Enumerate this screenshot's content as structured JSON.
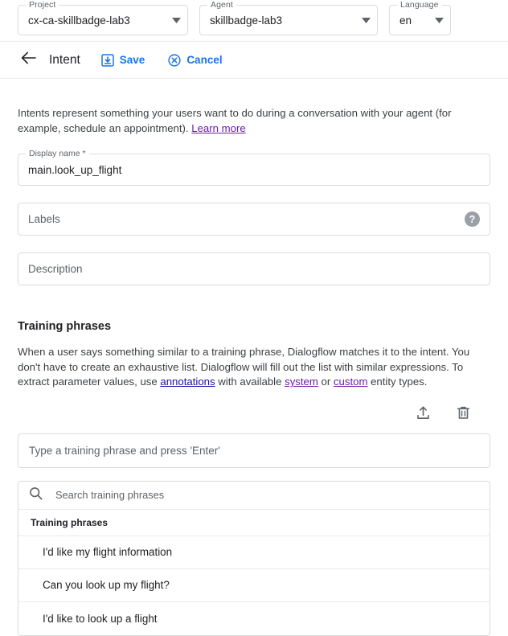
{
  "selectors": [
    {
      "legend": "Project",
      "value": "cx-ca-skillbadge-lab3",
      "icon": "chevron-down-icon"
    },
    {
      "legend": "Agent",
      "value": "skillbadge-lab3",
      "icon": "chevron-down-icon"
    },
    {
      "legend": "Language",
      "value": "en",
      "icon": "chevron-down-icon"
    }
  ],
  "header": {
    "back_icon": "arrow-back-icon",
    "title": "Intent",
    "save_label": "Save",
    "save_icon": "save-icon",
    "cancel_label": "Cancel",
    "cancel_icon": "cancel-circle-icon"
  },
  "intro": {
    "text_before": "Intents represent something your users want to do during a conversation with your agent (for example, schedule an appointment). ",
    "link_label": "Learn more"
  },
  "fields": {
    "display_name": {
      "legend": "Display name *",
      "value": "main.look_up_flight"
    },
    "labels": {
      "placeholder": "Labels",
      "help_icon": "help-circle-icon"
    },
    "description": {
      "placeholder": "Description"
    }
  },
  "training": {
    "section_title": "Training phrases",
    "desc_part1": "When a user says something similar to a training phrase, Dialogflow matches it to the intent. You don't have to create an exhaustive list. Dialogflow will fill out the list with similar expressions. To extract parameter values, use ",
    "link_annotations": "annotations",
    "desc_part2": " with available ",
    "link_system": "system",
    "desc_part3": " or ",
    "link_custom": "custom",
    "desc_part4": " entity types.",
    "upload_icon": "upload-icon",
    "delete_icon": "delete-trash-icon",
    "phrase_placeholder": "Type a training phrase and press 'Enter'",
    "search_icon": "search-icon",
    "search_placeholder": "Search training phrases",
    "column_header": "Training phrases",
    "rows": [
      "I'd like my flight information",
      "Can you look up my flight?",
      "I'd like to look up a flight"
    ]
  },
  "colors": {
    "accent_blue": "#1a73e8",
    "link_visited": "#681da8",
    "link_blue": "#1a0dab",
    "border": "#dadce0",
    "text_primary": "#202124",
    "text_secondary": "#5f6368"
  }
}
